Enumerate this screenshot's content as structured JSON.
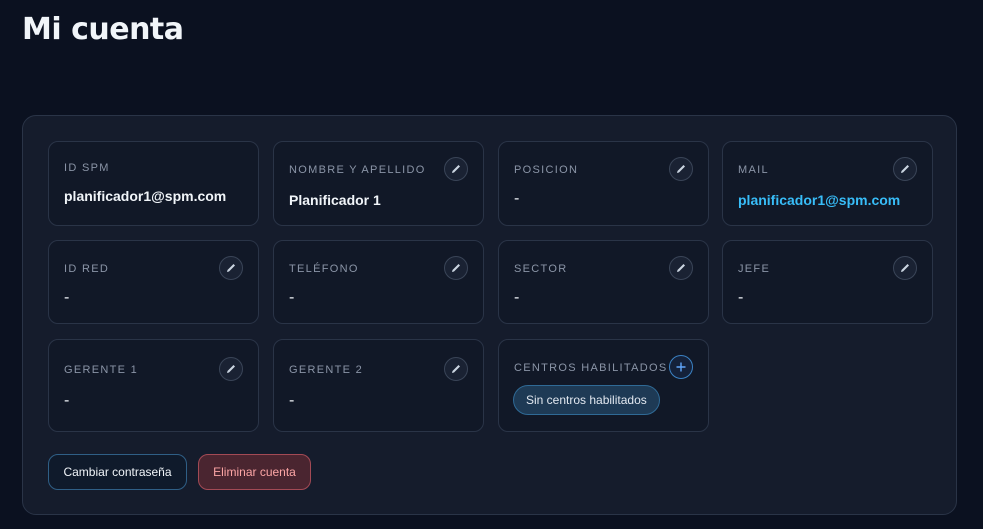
{
  "page": {
    "title": "Mi cuenta"
  },
  "fields": {
    "id_spm": {
      "label": "ID SPM",
      "value": "planificador1@spm.com"
    },
    "nombre": {
      "label": "NOMBRE Y APELLIDO",
      "value": "Planificador 1"
    },
    "posicion": {
      "label": "POSICION",
      "value": "-"
    },
    "mail": {
      "label": "MAIL",
      "value": "planificador1@spm.com"
    },
    "id_red": {
      "label": "ID RED",
      "value": "-"
    },
    "telefono": {
      "label": "TELÉFONO",
      "value": "-"
    },
    "sector": {
      "label": "SECTOR",
      "value": "-"
    },
    "jefe": {
      "label": "JEFE",
      "value": "-"
    },
    "gerente1": {
      "label": "GERENTE 1",
      "value": "-"
    },
    "gerente2": {
      "label": "GERENTE 2",
      "value": "-"
    },
    "centros": {
      "label": "CENTROS HABILITADOS",
      "chip": "Sin centros habilitados"
    }
  },
  "actions": {
    "change_password": "Cambiar contraseña",
    "delete_account": "Eliminar cuenta"
  },
  "icons": {
    "edit": "pencil-icon",
    "add": "plus-icon"
  },
  "colors": {
    "accent": "#38bdf8",
    "danger": "#fca5a5",
    "background": "#0b1120"
  }
}
